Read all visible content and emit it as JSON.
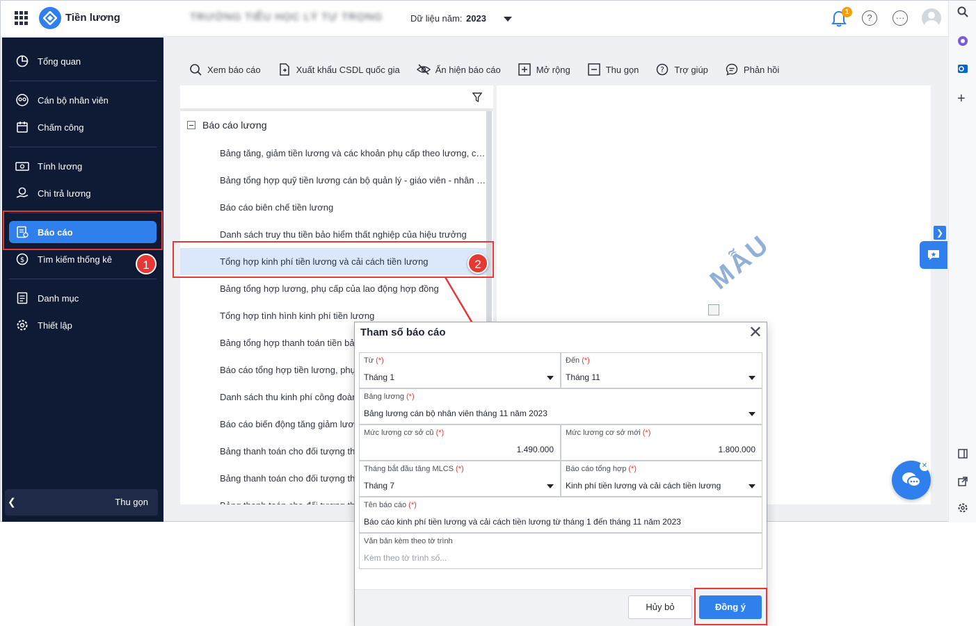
{
  "header": {
    "app_name": "Tiền lương",
    "school_name": "TRƯỜNG TIỂU HỌC LÝ TỰ TRỌNG",
    "year_label": "Dữ liệu năm:",
    "year_value": "2023",
    "notification_count": "1"
  },
  "sidebar": {
    "items": [
      {
        "label": "Tổng quan",
        "icon": "pie-chart-icon"
      },
      {
        "label": "Cán bộ nhân viên",
        "icon": "users-icon"
      },
      {
        "label": "Chấm công",
        "icon": "calendar-icon"
      },
      {
        "label": "Tính lương",
        "icon": "money-icon"
      },
      {
        "label": "Chi trả lương",
        "icon": "pay-icon"
      },
      {
        "label": "Báo cáo",
        "icon": "report-icon",
        "active": true
      },
      {
        "label": "Tìm kiếm thống kê",
        "icon": "dollar-search-icon"
      },
      {
        "label": "Danh mục",
        "icon": "list-icon"
      },
      {
        "label": "Thiết lập",
        "icon": "gear-icon"
      }
    ],
    "collapse_label": "Thu gọn"
  },
  "toolbar": {
    "view": "Xem báo cáo",
    "export": "Xuất khẩu CSDL quốc gia",
    "toggle": "Ẩn hiện báo cáo",
    "expand": "Mở rộng",
    "collapse": "Thu gọn",
    "help": "Trợ giúp",
    "feedback": "Phản hồi"
  },
  "report_list": {
    "group_title": "Báo cáo lương",
    "items": [
      "Bảng tăng, giảm tiền lương và các khoản phụ cấp theo lương, cá...",
      "Bảng tổng hợp quỹ tiền lương cán bộ quản lý - giáo viên - nhân vi...",
      "Báo cáo biên chế tiền lương",
      "Danh sách truy thu tiền bảo hiểm thất nghiệp của hiệu trưởng",
      "Tổng hợp kinh phí tiền lương và cải cách tiền lương",
      "Bảng tổng hợp lương, phụ cấp của lao động hợp đồng",
      "Tổng hợp tình hình kinh phí tiền lương",
      "Bảng tổng hợp thanh toán tiền bả",
      "Báo cáo tổng hợp tiền lương, phụ",
      "Danh sách thu kinh phí công đoàn",
      "Báo cáo biến động tăng giảm lươ",
      "Bảng thanh toán cho đối tượng th",
      "Bảng thanh toán cho đối tượng th",
      "Bảng thanh toán cho đối tượng th"
    ],
    "selected_index": 4
  },
  "preview": {
    "watermark": "MẪU"
  },
  "callouts": {
    "step1": "1",
    "step2": "2"
  },
  "dialog": {
    "title": "Tham số báo cáo",
    "required_mark": "(*)",
    "from_label": "Từ",
    "from_value": "Tháng 1",
    "to_label": "Đến",
    "to_value": "Tháng 11",
    "payroll_label": "Bảng lương",
    "payroll_value": "Bảng lương cán bộ nhân viên tháng 11 năm 2023",
    "old_base_label": "Mức lương cơ sở cũ",
    "old_base_value": "1.490.000",
    "new_base_label": "Mức lương cơ sở mới",
    "new_base_value": "1.800.000",
    "start_month_label": "Tháng bắt đầu tăng MLCS",
    "start_month_value": "Tháng 7",
    "summary_label": "Báo cáo tổng hợp",
    "summary_value": "Kinh phí tiền lương và cải cách tiền lương",
    "name_label": "Tên báo cáo",
    "name_value": "Báo cáo kinh phí tiền lương và cải cách tiền lương từ tháng 1 đến tháng 11 năm 2023",
    "attach_label": "Văn bản kèm theo tờ trình",
    "attach_placeholder": "Kèm theo tờ trình số...",
    "cancel": "Hủy bỏ",
    "ok": "Đồng ý"
  },
  "colors": {
    "accent": "#2f80ed",
    "sidebar_bg": "#0f1a35",
    "highlight": "#e53935"
  }
}
